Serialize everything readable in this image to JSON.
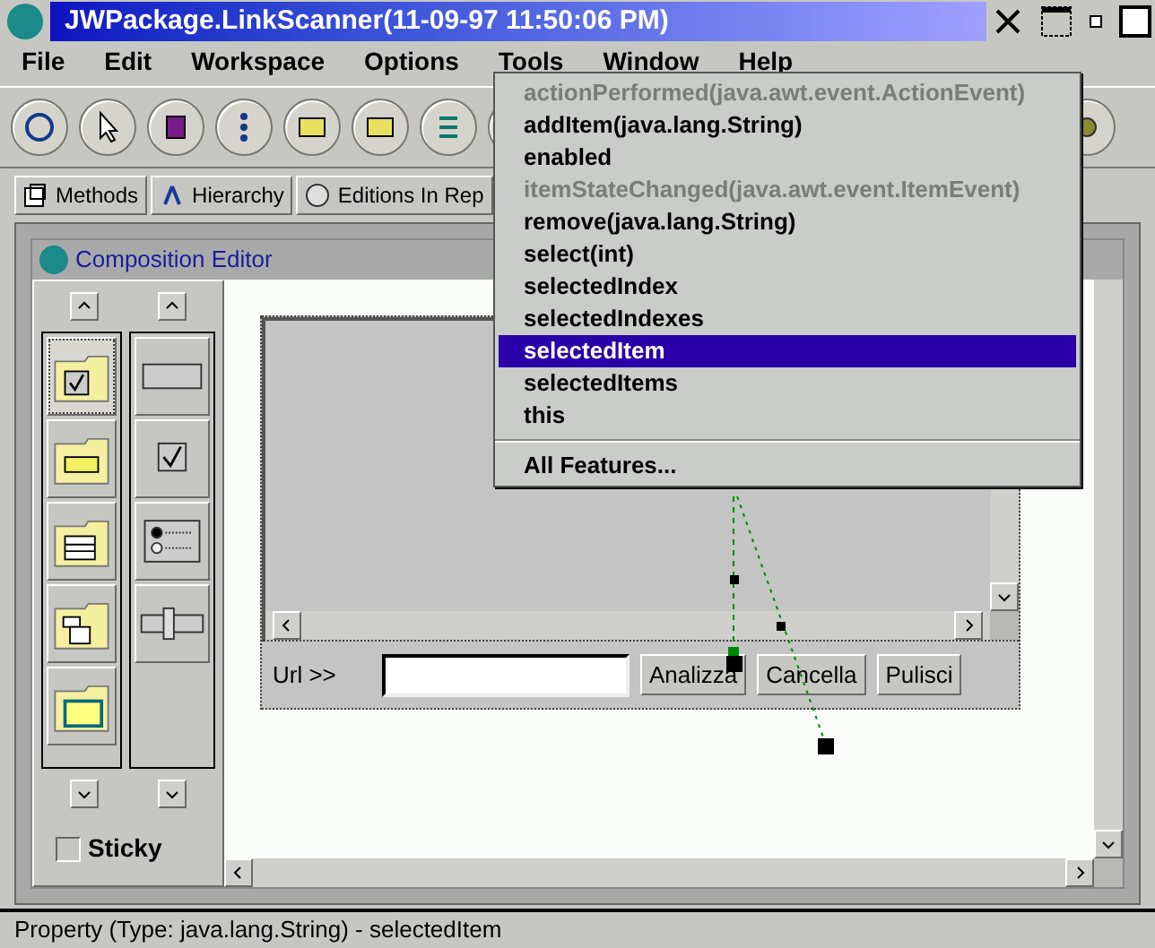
{
  "window": {
    "title": "JWPackage.LinkScanner(11-09-97 11:50:06 PM)"
  },
  "menubar": [
    {
      "label": "File",
      "selected": false
    },
    {
      "label": "Edit",
      "selected": false
    },
    {
      "label": "Workspace",
      "selected": false
    },
    {
      "label": "Options",
      "selected": false
    },
    {
      "label": "Tools",
      "selected": false
    },
    {
      "label": "Window",
      "selected": false
    },
    {
      "label": "Help",
      "selected": false
    }
  ],
  "tabs": [
    {
      "label": "Methods",
      "selected": false,
      "kind": "methods"
    },
    {
      "label": "Hierarchy",
      "selected": false,
      "kind": "hierarchy"
    },
    {
      "label": "Editions In Rep",
      "selected": false,
      "kind": "editions"
    }
  ],
  "editor": {
    "title": "Composition Editor",
    "sticky": {
      "label": "Sticky",
      "checked": false
    },
    "categories": [
      {
        "kind": "checkbox",
        "selected": true
      },
      {
        "kind": "textfield",
        "selected": false
      },
      {
        "kind": "list",
        "selected": false
      },
      {
        "kind": "tree",
        "selected": false
      },
      {
        "kind": "window",
        "selected": false
      }
    ],
    "components": [
      {
        "kind": "button",
        "selected": false
      },
      {
        "kind": "checkbox",
        "selected": false
      },
      {
        "kind": "radio",
        "selected": false
      },
      {
        "kind": "slider",
        "selected": false
      }
    ],
    "applet": {
      "url_label": "Url >>",
      "buttons": [
        "Analizza",
        "Cancella",
        "Pulisci"
      ]
    }
  },
  "popup_menu": {
    "items": [
      {
        "label": "actionPerformed(java.awt.event.ActionEvent)",
        "disabled": true,
        "selected": false
      },
      {
        "label": "addItem(java.lang.String)",
        "disabled": false,
        "selected": false
      },
      {
        "label": "enabled",
        "disabled": false,
        "selected": false
      },
      {
        "label": "itemStateChanged(java.awt.event.ItemEvent)",
        "disabled": true,
        "selected": false
      },
      {
        "label": "remove(java.lang.String)",
        "disabled": false,
        "selected": false
      },
      {
        "label": "select(int)",
        "disabled": false,
        "selected": false
      },
      {
        "label": "selectedIndex",
        "disabled": false,
        "selected": false
      },
      {
        "label": "selectedIndexes",
        "disabled": false,
        "selected": false
      },
      {
        "label": "selectedItem",
        "disabled": false,
        "selected": true
      },
      {
        "label": "selectedItems",
        "disabled": false,
        "selected": false
      },
      {
        "label": "this",
        "disabled": false,
        "selected": false
      }
    ],
    "footer_item": "All Features..."
  },
  "status_bar": "Property (Type: java.lang.String) - selectedItem"
}
